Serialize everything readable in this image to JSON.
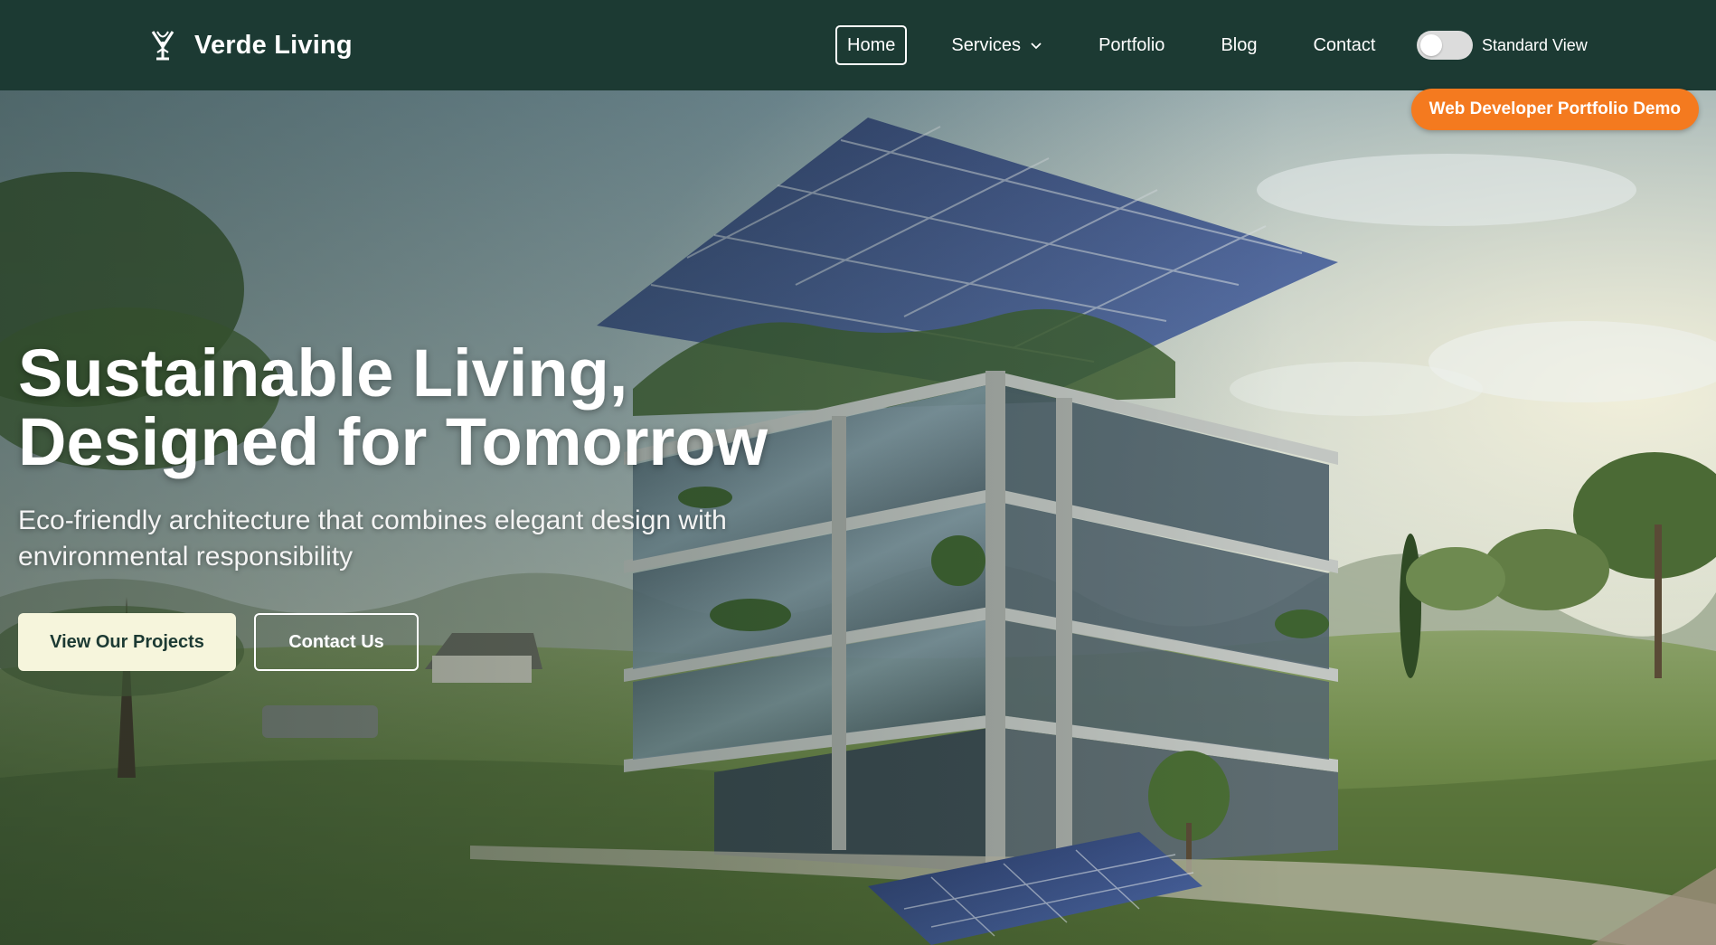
{
  "brand": {
    "name": "Verde Living",
    "logo_icon": "leaf-shield-logo-icon"
  },
  "nav": {
    "items": [
      {
        "label": "Home",
        "active": true
      },
      {
        "label": "Services",
        "has_dropdown": true
      },
      {
        "label": "Portfolio"
      },
      {
        "label": "Blog"
      },
      {
        "label": "Contact"
      }
    ],
    "dropdown_icon": "chevron-down-icon",
    "view_toggle": {
      "label": "Standard View",
      "enabled": false
    }
  },
  "badge": {
    "label": "Web Developer Portfolio Demo"
  },
  "hero": {
    "title_line1": "Sustainable Living,",
    "title_line2": "Designed for Tomorrow",
    "subtitle": "Eco-friendly architecture that combines elegant design with environmental responsibility",
    "primary_cta": "View Our Projects",
    "secondary_cta": "Contact Us"
  },
  "colors": {
    "nav_bg": "#1c3a33",
    "badge_bg": "#f47a1f",
    "primary_btn_bg": "#f6f5dc",
    "primary_btn_text": "#1c3a33"
  }
}
